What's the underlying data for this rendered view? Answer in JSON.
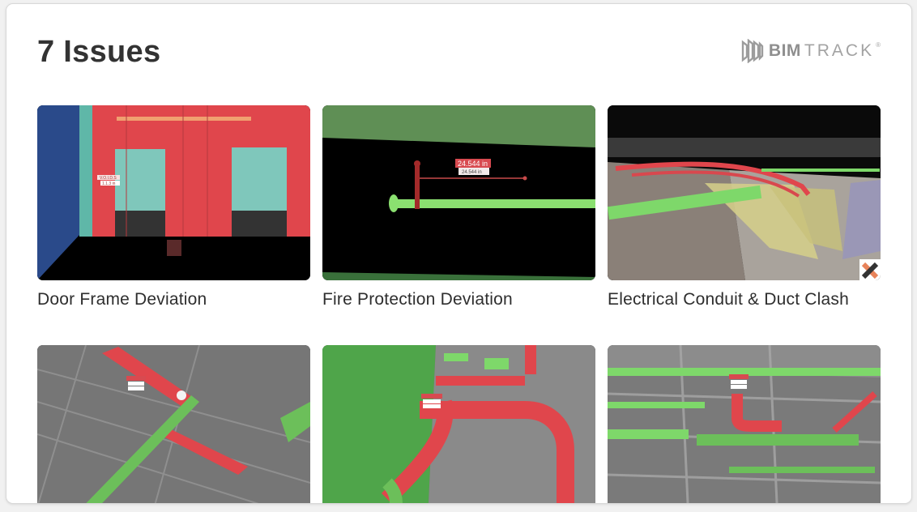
{
  "header": {
    "title": "7 Issues",
    "logo": {
      "bim": "BIM",
      "track": "TRACK",
      "reg": "®"
    }
  },
  "issues": [
    {
      "title": "Door Frame Deviation",
      "thumbnail_icon": "door-frame-scan",
      "badges": {
        "a": "V.O.I.D.S",
        "b": "1.1.3 in"
      }
    },
    {
      "title": "Fire Protection Deviation",
      "thumbnail_icon": "fire-pipe-scan",
      "badges": {
        "a": "24.544 in",
        "b": "24.544 in"
      }
    },
    {
      "title": "Electrical Conduit & Duct Clash",
      "thumbnail_icon": "conduit-duct-scan"
    },
    {
      "title": "",
      "thumbnail_icon": "ceiling-scan"
    },
    {
      "title": "",
      "thumbnail_icon": "duct-scan"
    },
    {
      "title": "",
      "thumbnail_icon": "mep-scan"
    }
  ],
  "colors": {
    "background": "#f1f1f1",
    "card": "#ffffff",
    "text": "#333333",
    "model_red": "#e04a4f",
    "model_green": "#7ee06a"
  }
}
